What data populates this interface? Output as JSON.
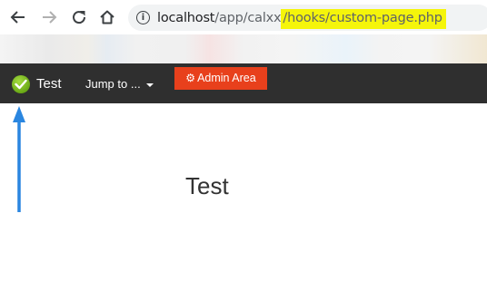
{
  "browser": {
    "url_host": "localhost",
    "url_path_plain": "/app/calxx",
    "url_path_highlighted": "/hooks/custom-page.php",
    "icons": [
      "back-arrow-icon",
      "forward-arrow-icon",
      "reload-icon",
      "home-icon",
      "info-icon"
    ]
  },
  "navbar": {
    "brand_label": "Test",
    "jump_label": "Jump to ...",
    "admin_label": "Admin Area",
    "colors": {
      "bar": "#2f2f2f",
      "admin": "#e8401c",
      "brand_check": "#7dbd1f"
    }
  },
  "page": {
    "title": "Test"
  },
  "annotations": {
    "arrow_color": "#2a86e0",
    "highlight_color": "#f5f50a"
  }
}
